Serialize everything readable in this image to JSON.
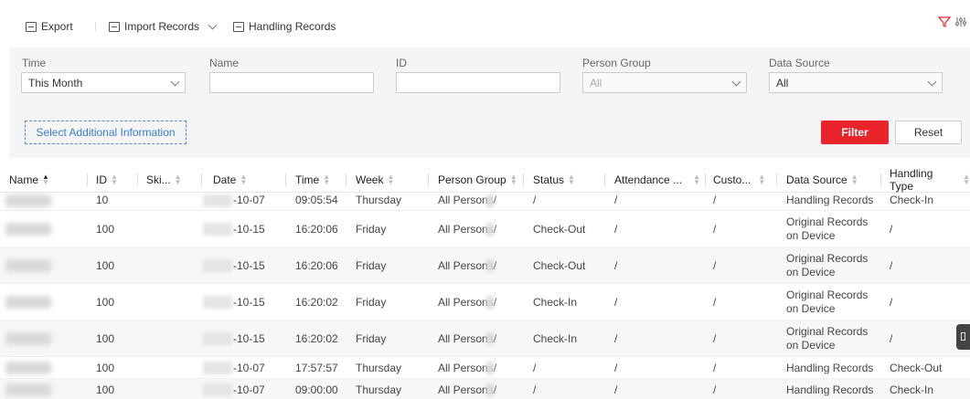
{
  "toolbar": {
    "export_label": "Export",
    "import_label": "Import Records",
    "handling_label": "Handling Records"
  },
  "filters": {
    "time_label": "Time",
    "time_value": "This Month",
    "name_label": "Name",
    "name_value": "",
    "id_label": "ID",
    "id_value": "",
    "group_label": "Person Group",
    "group_value": "All",
    "source_label": "Data Source",
    "source_value": "All",
    "additional_label": "Select Additional Information",
    "filter_label": "Filter",
    "reset_label": "Reset"
  },
  "table": {
    "headers": [
      "Name",
      "ID",
      "Ski...",
      "Date",
      "Time",
      "Week",
      "Person Group",
      "Status",
      "Attendance ...",
      "Custo...",
      "Data Source",
      "Handling Type"
    ],
    "rows": [
      {
        "id": "10",
        "date": "-10-07",
        "time": "09:05:54",
        "week": "Thursday",
        "group": "All Persons/",
        "status": "/",
        "attendance": "/",
        "custom": "/",
        "source": "Handling Records",
        "handling": "Check-In"
      },
      {
        "id": "100",
        "date": "-10-15",
        "time": "16:20:06",
        "week": "Friday",
        "group": "All Persons/",
        "status": "Check-Out",
        "attendance": "/",
        "custom": "/",
        "source": "Original Records on Device",
        "handling": "/"
      },
      {
        "id": "100",
        "date": "-10-15",
        "time": "16:20:06",
        "week": "Friday",
        "group": "All Persons/",
        "status": "Check-Out",
        "attendance": "/",
        "custom": "/",
        "source": "Original Records on Device",
        "handling": "/"
      },
      {
        "id": "100",
        "date": "-10-15",
        "time": "16:20:02",
        "week": "Friday",
        "group": "All Persons/",
        "status": "Check-In",
        "attendance": "/",
        "custom": "/",
        "source": "Original Records on Device",
        "handling": "/"
      },
      {
        "id": "100",
        "date": "-10-15",
        "time": "16:20:02",
        "week": "Friday",
        "group": "All Persons/",
        "status": "Check-In",
        "attendance": "/",
        "custom": "/",
        "source": "Original Records on Device",
        "handling": "/"
      },
      {
        "id": "100",
        "date": "-10-07",
        "time": "17:57:57",
        "week": "Thursday",
        "group": "All Persons/",
        "status": "/",
        "attendance": "/",
        "custom": "/",
        "source": "Handling Records",
        "handling": "Check-Out"
      },
      {
        "id": "100",
        "date": "-10-07",
        "time": "09:00:00",
        "week": "Thursday",
        "group": "All Persons/",
        "status": "/",
        "attendance": "/",
        "custom": "/",
        "source": "Handling Records",
        "handling": "Check-In"
      }
    ]
  },
  "colors": {
    "accent": "#e9252b",
    "link": "#3a7dcc"
  }
}
